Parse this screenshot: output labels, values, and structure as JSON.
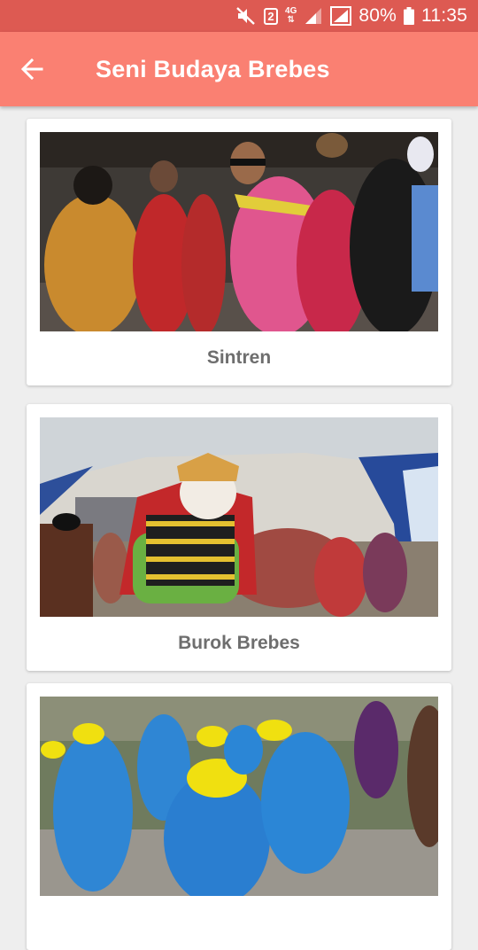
{
  "status_bar": {
    "badge": "2",
    "network": "4G",
    "battery_level": "80%",
    "time": "11:35"
  },
  "app_bar": {
    "title": "Seni Budaya Brebes"
  },
  "colors": {
    "status_bar": "#dd5a52",
    "app_bar": "#fa8072",
    "background": "#eeeeee",
    "card": "#ffffff",
    "label_text": "#6e6e6e"
  },
  "icons": [
    "mute-icon",
    "notification-badge-icon",
    "signal-icon",
    "signal-alt-icon",
    "battery-icon",
    "back-arrow-icon"
  ],
  "items": [
    {
      "label": "Sintren"
    },
    {
      "label": "Burok Brebes"
    },
    {
      "label": ""
    }
  ]
}
